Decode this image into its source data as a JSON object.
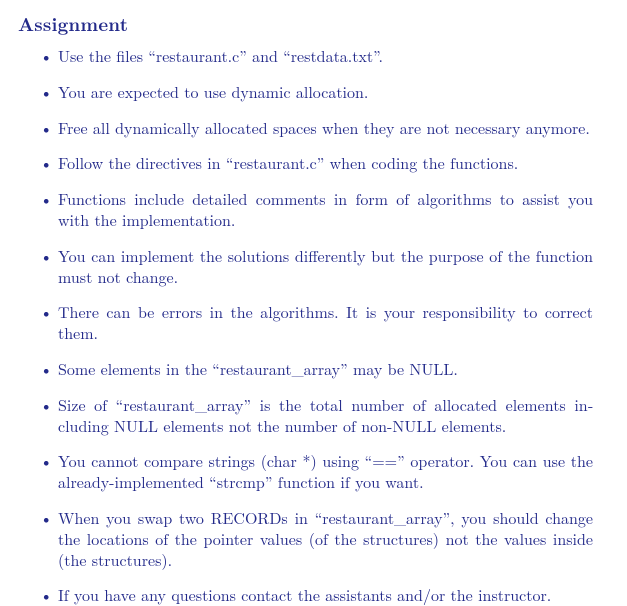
{
  "heading": "Assignment",
  "items": [
    "Use the files “restaurant.c” and “restdata.txt”.",
    "You are expected to use dynamic allocation.",
    "Free all dynamically allocated spaces when they are not necessary any­more.",
    "Follow the directives in “restaurant.c” when coding the functions.",
    "Functions include detailed comments in form of algorithms to assist you with the implementation.",
    "You can implement the solutions differently but the purpose of the function must not change.",
    "There can be errors in the algorithms. It is your responsibility to correct them.",
    "Some elements in the “restaurant_array” may be NULL.",
    "Size of “restaurant_array” is the total number of allocated elements in­cluding NULL elements not the number of non-NULL elements.",
    "You cannot compare strings (char *) using “==” operator. You can use the already-implemented “strcmp” function if you want.",
    "When you swap two RECORDs in “restaurant_array”, you should change the locations of the pointer values (of the structures) not the values inside (the structures).",
    "If you have any questions contact the assistants and/or the instructor."
  ]
}
